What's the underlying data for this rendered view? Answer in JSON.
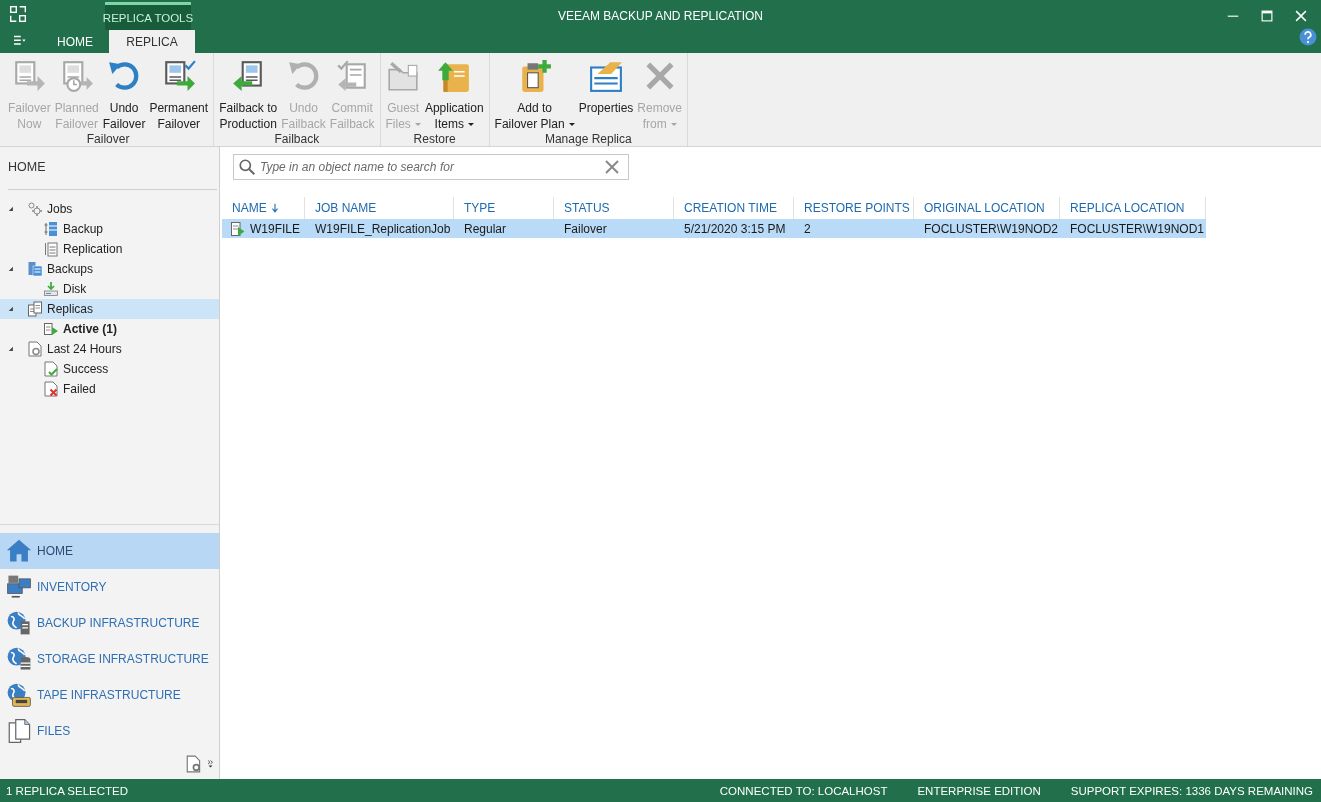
{
  "window": {
    "title": "VEEAM BACKUP AND REPLICATION",
    "context_tab_label": "REPLICA TOOLS"
  },
  "tabs": [
    {
      "label": "HOME",
      "selected": false
    },
    {
      "label": "REPLICA",
      "selected": true
    }
  ],
  "ribbon": {
    "groups": [
      {
        "label": "Failover",
        "buttons": [
          {
            "kind": "failover-now",
            "lines": [
              "Failover",
              "Now"
            ],
            "disabled": true,
            "dropdown": false
          },
          {
            "kind": "planned-failover",
            "lines": [
              "Planned",
              "Failover"
            ],
            "disabled": true,
            "dropdown": false
          },
          {
            "kind": "undo",
            "lines": [
              "Undo",
              "Failover"
            ],
            "disabled": false,
            "dropdown": false
          },
          {
            "kind": "permanent-failover",
            "lines": [
              "Permanent",
              "Failover"
            ],
            "disabled": false,
            "dropdown": false
          }
        ]
      },
      {
        "label": "Failback",
        "buttons": [
          {
            "kind": "failback",
            "lines": [
              "Failback to",
              "Production"
            ],
            "disabled": false,
            "dropdown": false
          },
          {
            "kind": "undo",
            "lines": [
              "Undo",
              "Failback"
            ],
            "disabled": true,
            "dropdown": false
          },
          {
            "kind": "commit-failback",
            "lines": [
              "Commit",
              "Failback"
            ],
            "disabled": true,
            "dropdown": false
          }
        ]
      },
      {
        "label": "Restore",
        "buttons": [
          {
            "kind": "guest-files",
            "lines": [
              "Guest",
              "Files"
            ],
            "disabled": true,
            "dropdown": true
          },
          {
            "kind": "application-items",
            "lines": [
              "Application",
              "Items"
            ],
            "disabled": false,
            "dropdown": true
          }
        ]
      },
      {
        "label": "Manage Replica",
        "buttons": [
          {
            "kind": "add-to-plan",
            "lines": [
              "Add to",
              "Failover Plan"
            ],
            "disabled": false,
            "dropdown": true
          },
          {
            "kind": "properties",
            "lines": [
              "Properties"
            ],
            "disabled": false,
            "dropdown": false
          },
          {
            "kind": "remove",
            "lines": [
              "Remove",
              "from"
            ],
            "disabled": true,
            "dropdown": true
          }
        ]
      }
    ]
  },
  "sidebar": {
    "header": "HOME",
    "tree": [
      {
        "kind": "jobs",
        "label": "Jobs",
        "expanded": true,
        "selected": false,
        "bold": false,
        "children": [
          {
            "kind": "backup-job",
            "label": "Backup",
            "selected": false,
            "bold": false
          },
          {
            "kind": "replication-job",
            "label": "Replication",
            "selected": false,
            "bold": false
          }
        ]
      },
      {
        "kind": "backups",
        "label": "Backups",
        "expanded": true,
        "selected": false,
        "bold": false,
        "children": [
          {
            "kind": "disk",
            "label": "Disk",
            "selected": false,
            "bold": false
          }
        ]
      },
      {
        "kind": "replicas",
        "label": "Replicas",
        "expanded": true,
        "selected": true,
        "bold": false,
        "children": [
          {
            "kind": "active",
            "label": "Active (1)",
            "selected": false,
            "bold": true
          }
        ]
      },
      {
        "kind": "last24",
        "label": "Last 24 Hours",
        "expanded": true,
        "selected": false,
        "bold": false,
        "children": [
          {
            "kind": "success",
            "label": "Success",
            "selected": false,
            "bold": false
          },
          {
            "kind": "failed",
            "label": "Failed",
            "selected": false,
            "bold": false
          }
        ]
      }
    ],
    "nav": [
      {
        "kind": "home",
        "label": "HOME",
        "selected": true
      },
      {
        "kind": "inventory",
        "label": "INVENTORY",
        "selected": false
      },
      {
        "kind": "backup-infra",
        "label": "BACKUP INFRASTRUCTURE",
        "selected": false
      },
      {
        "kind": "storage-infra",
        "label": "STORAGE INFRASTRUCTURE",
        "selected": false
      },
      {
        "kind": "tape-infra",
        "label": "TAPE INFRASTRUCTURE",
        "selected": false
      },
      {
        "kind": "files",
        "label": "FILES",
        "selected": false
      }
    ]
  },
  "search": {
    "placeholder": "Type in an object name to search for"
  },
  "table": {
    "columns": [
      {
        "label": "NAME",
        "sorted": true
      },
      {
        "label": "JOB NAME",
        "sorted": false
      },
      {
        "label": "TYPE",
        "sorted": false
      },
      {
        "label": "STATUS",
        "sorted": false
      },
      {
        "label": "CREATION TIME",
        "sorted": false
      },
      {
        "label": "RESTORE POINTS",
        "sorted": false
      },
      {
        "label": "ORIGINAL LOCATION",
        "sorted": false
      },
      {
        "label": "REPLICA LOCATION",
        "sorted": false
      }
    ],
    "rows": [
      {
        "selected": true,
        "cells": [
          "W19FILE",
          "W19FILE_ReplicationJob",
          "Regular",
          "Failover",
          "5/21/2020 3:15 PM",
          "2",
          "FOCLUSTER\\W19NOD2",
          "FOCLUSTER\\W19NOD1"
        ]
      }
    ]
  },
  "status_bar": {
    "left": "1 REPLICA SELECTED",
    "right": [
      "CONNECTED TO: LOCALHOST",
      "ENTERPRISE EDITION",
      "SUPPORT EXPIRES: 1336 DAYS REMAINING"
    ]
  }
}
